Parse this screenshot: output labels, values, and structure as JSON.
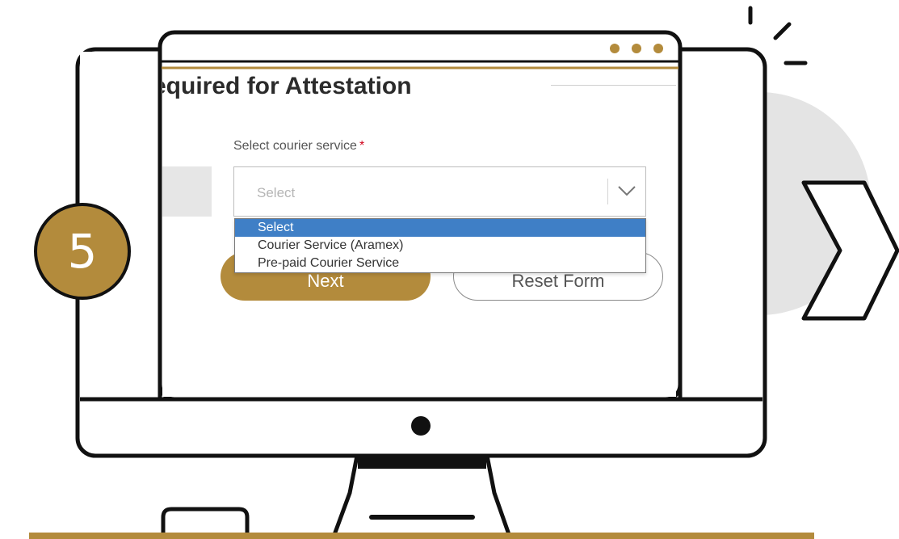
{
  "step": {
    "number": "5"
  },
  "form": {
    "heading": "equired for Attestation",
    "courier_label": "Select courier service",
    "required_marker": "*",
    "select_value": "Select",
    "options": [
      {
        "label": "Select",
        "selected": true
      },
      {
        "label": "Courier Service (Aramex)",
        "selected": false
      },
      {
        "label": "Pre-paid Courier Service",
        "selected": false
      }
    ],
    "next_label": "Next",
    "reset_label": "Reset Form"
  },
  "colors": {
    "accent_gold": "#b38b3c",
    "selection_blue": "#3f7fc6",
    "required_red": "#d0021b"
  }
}
